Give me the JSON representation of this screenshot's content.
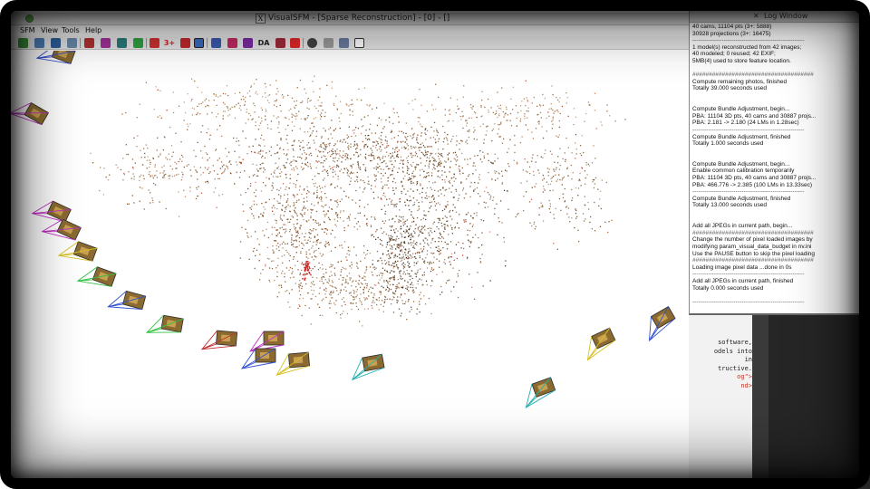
{
  "window": {
    "title": "VisualSFM - [Sparse Reconstruction] - [0] - []",
    "app_glyph": "X"
  },
  "menu": [
    "SFM",
    "View",
    "Tools",
    "Help"
  ],
  "toolbar": {
    "text_buttons": {
      "three_plus": "3+",
      "ba": "DA"
    },
    "icons": [
      "open-icon",
      "open-multi-icon",
      "save-icon",
      "folder-icon",
      "pair-match-icon",
      "match-icon",
      "feature-icon",
      "color-icon",
      "rotate-icon",
      "three-plus",
      "grid-icon",
      "sfm-icon",
      "fit-icon",
      "arrows-icon",
      "fly-icon",
      "ba",
      "bundle-icon",
      "pause-icon",
      "gear-icon",
      "hand-icon",
      "window-icon"
    ]
  },
  "log_window": {
    "title": "Log Window",
    "lines": [
      "40 cams, 11104 pts (3+: 5888)",
      "30928 projections (3+: 16475)",
      "---------------------------------------------------------",
      "1 model(s) reconstructed from 42 images;",
      "40 modeled; 0 reused; 42 EXIF;",
      "5MB(4) used to store feature location.",
      "",
      "#####################################",
      "Compute remaining photos, finished",
      "Totally 39.000 seconds used",
      "",
      "",
      "Compute Bundle Adjustment, begin...",
      "PBA: 11104 3D pts, 40 cams and 30887 projs...",
      "PBA: 2.181 -> 2.180 (24 LMs in 1.28sec)",
      "---------------------------------------------------------",
      "Compute Bundle Adjustment, finished",
      "Totally 1.000 seconds used",
      "",
      "",
      "Compute Bundle Adjustment, begin...",
      "Enable common calibration temporarily",
      "PBA: 11104 3D pts, 40 cams and 30887 projs...",
      "PBA: 466.776 -> 2.385 (100 LMs in 13.33sec)",
      "---------------------------------------------------------",
      "Compute Bundle Adjustment, finished",
      "Totally 13.000 seconds used",
      "",
      "",
      "Add all JPEGs in current path, begin...",
      "#####################################",
      "Change the number of pixel loaded images by",
      "modifying param_visual_data_budget in nv.ini",
      "Use the PAUSE button to skip the pixel loading",
      "#####################################",
      "Loading image pixel data ...done in 0s",
      "---------------------------------------------------------",
      "Add all JPEGs in current path, finished",
      "Totally 0.000 seconds used",
      "",
      "---------------------------------------------------------"
    ]
  },
  "background_editor": {
    "lines": [
      "software,",
      "odels into",
      "in",
      "",
      "tructive.",
      "",
      "",
      "",
      "",
      "og\">",
      "nd>"
    ]
  },
  "colors": {
    "title_bar": "#dcdcdc",
    "point_brown": "#7a4a1a",
    "camera_magenta": "#c030c0",
    "camera_yellow": "#d8c020",
    "camera_green": "#30c040",
    "camera_blue": "#3050d0",
    "camera_cyan": "#20b0b0",
    "camera_red": "#c03030"
  }
}
